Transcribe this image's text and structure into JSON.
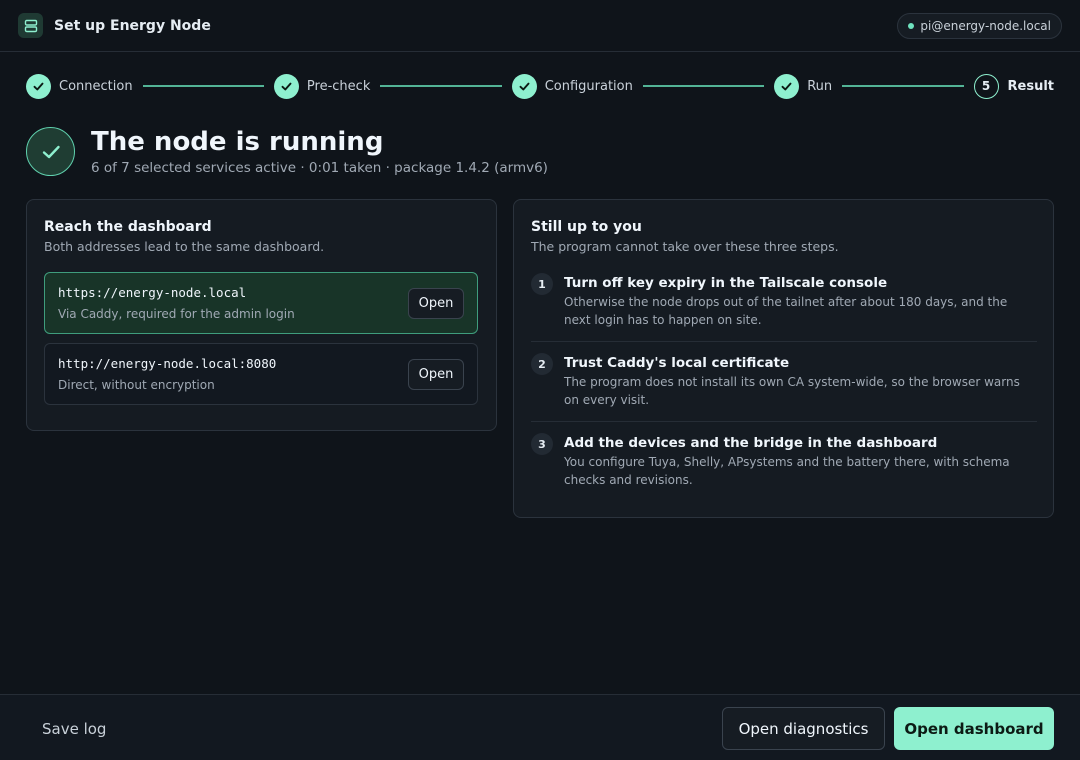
{
  "app": {
    "title": "Set up Energy Node",
    "host": "pi@energy-node.local",
    "icon": "server-icon"
  },
  "stepper": {
    "steps": [
      {
        "label": "Connection",
        "state": "done"
      },
      {
        "label": "Pre-check",
        "state": "done"
      },
      {
        "label": "Configuration",
        "state": "done"
      },
      {
        "label": "Run",
        "state": "done"
      },
      {
        "label": "Result",
        "state": "current",
        "number": "5"
      }
    ]
  },
  "hero": {
    "title": "The node is running",
    "subtitle": "6 of 7 selected services active · 0:01 taken · package 1.4.2 (armv6)"
  },
  "dashboard_card": {
    "title": "Reach the dashboard",
    "subtitle": "Both addresses lead to the same dashboard.",
    "addresses": [
      {
        "url": "https://energy-node.local",
        "description": "Via Caddy, required for the admin login",
        "button": "Open"
      },
      {
        "url": "http://energy-node.local:8080",
        "description": "Direct, without encryption",
        "button": "Open"
      }
    ]
  },
  "todo_card": {
    "title": "Still up to you",
    "subtitle": "The program cannot take over these three steps.",
    "items": [
      {
        "number": "1",
        "title": "Turn off key expiry in the Tailscale console",
        "description": "Otherwise the node drops out of the tailnet after about 180 days, and the next login has to happen on site."
      },
      {
        "number": "2",
        "title": "Trust Caddy's local certificate",
        "description": "The program does not install its own CA system-wide, so the browser warns on every visit."
      },
      {
        "number": "3",
        "title": "Add the devices and the bridge in the dashboard",
        "description": "You configure Tuya, Shelly, APsystems and the battery there, with schema checks and revisions."
      }
    ]
  },
  "footer": {
    "save_log": "Save log",
    "open_diagnostics": "Open diagnostics",
    "open_dashboard": "Open dashboard"
  },
  "colors": {
    "accent": "#8ef0cf",
    "background": "#0f141a",
    "card": "#151b22",
    "primary_address_bg": "#183428"
  }
}
